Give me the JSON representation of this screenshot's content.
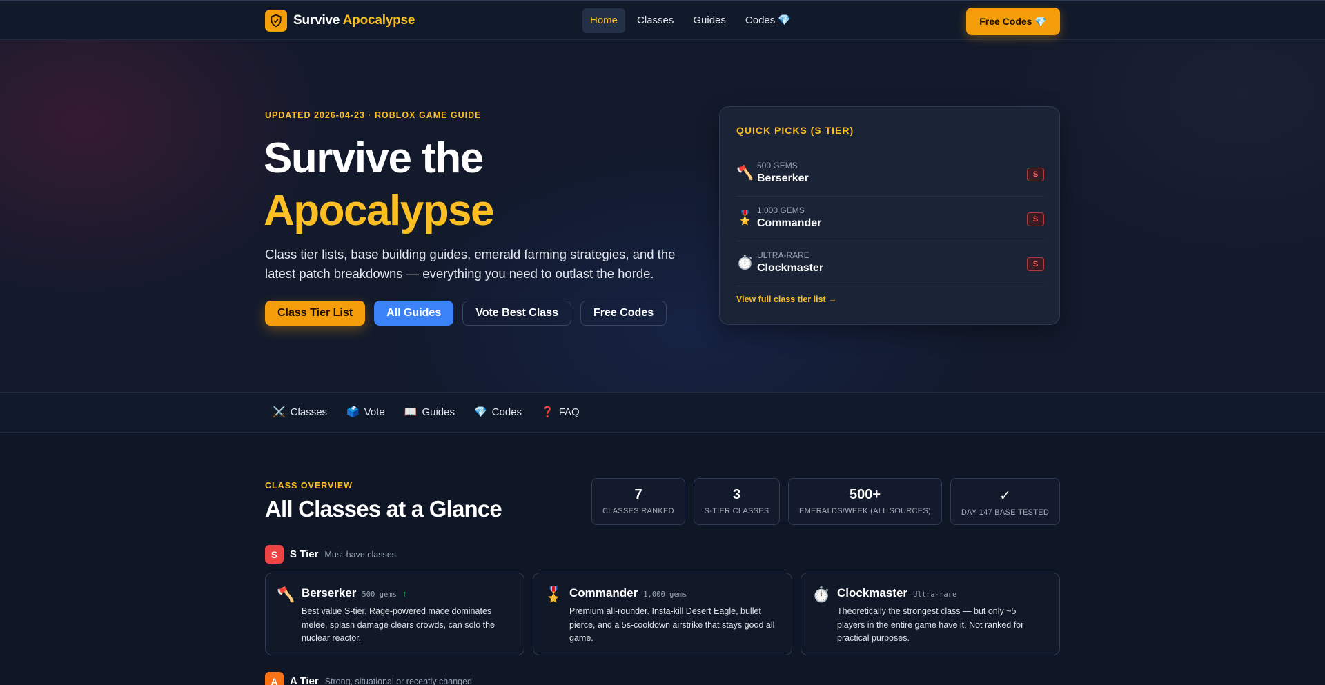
{
  "brand": {
    "name_prefix": "Survive",
    "name_accent": "Apocalypse"
  },
  "nav": {
    "items": [
      {
        "label": "Home",
        "active": true
      },
      {
        "label": "Classes"
      },
      {
        "label": "Guides"
      },
      {
        "label": "Codes 💎"
      }
    ],
    "cta": "Free Codes 💎"
  },
  "hero": {
    "eyebrow": "UPDATED 2026-04-23 · ROBLOX GAME GUIDE",
    "title_line1": "Survive the",
    "title_line2": "Apocalypse",
    "subtitle": "Class tier lists, base building guides, emerald farming strategies, and the latest patch breakdowns — everything you need to outlast the horde.",
    "buttons": [
      "Class Tier List",
      "All Guides",
      "Vote Best Class",
      "Free Codes"
    ]
  },
  "quick_picks": {
    "title": "QUICK PICKS (S TIER)",
    "items": [
      {
        "icon": "🪓",
        "small": "500 GEMS",
        "name": "Berserker",
        "tier": "S"
      },
      {
        "icon": "🎖️",
        "small": "1,000 GEMS",
        "name": "Commander",
        "tier": "S"
      },
      {
        "icon": "⏱️",
        "small": "ULTRA-RARE",
        "name": "Clockmaster",
        "tier": "S"
      }
    ],
    "link": "View full class tier list →"
  },
  "subnav": [
    {
      "icon": "⚔️",
      "label": "Classes"
    },
    {
      "icon": "🗳️",
      "label": "Vote"
    },
    {
      "icon": "📖",
      "label": "Guides"
    },
    {
      "icon": "💎",
      "label": "Codes"
    },
    {
      "icon": "❓",
      "label": "FAQ"
    }
  ],
  "overview": {
    "eyebrow": "CLASS OVERVIEW",
    "title": "All Classes at a Glance",
    "stats": [
      {
        "num": "7",
        "label": "CLASSES RANKED"
      },
      {
        "num": "3",
        "label": "S-TIER CLASSES"
      },
      {
        "num": "500+",
        "label": "EMERALDS/WEEK (ALL SOURCES)"
      },
      {
        "num": "✓",
        "label": "DAY 147 BASE TESTED"
      }
    ]
  },
  "tiers": {
    "s": {
      "badge": "S",
      "name": "S Tier",
      "desc": "Must-have classes",
      "color": "#ef4444"
    },
    "a": {
      "badge": "A",
      "name": "A Tier",
      "desc": "Strong, situational or recently changed",
      "color": "#f97316"
    }
  },
  "classes": [
    {
      "icon": "🪓",
      "name": "Berserker",
      "price": "500 gems",
      "trend": "↑",
      "desc": "Best value S-tier. Rage-powered mace dominates melee, splash damage clears crowds, can solo the nuclear reactor."
    },
    {
      "icon": "🎖️",
      "name": "Commander",
      "price": "1,000 gems",
      "trend": "",
      "desc": "Premium all-rounder. Insta-kill Desert Eagle, bullet pierce, and a 5s-cooldown airstrike that stays good all game."
    },
    {
      "icon": "⏱️",
      "name": "Clockmaster",
      "price": "Ultra-rare",
      "trend": "",
      "desc": "Theoretically the strongest class — but only ~5 players in the entire game have it. Not ranked for practical purposes."
    }
  ]
}
